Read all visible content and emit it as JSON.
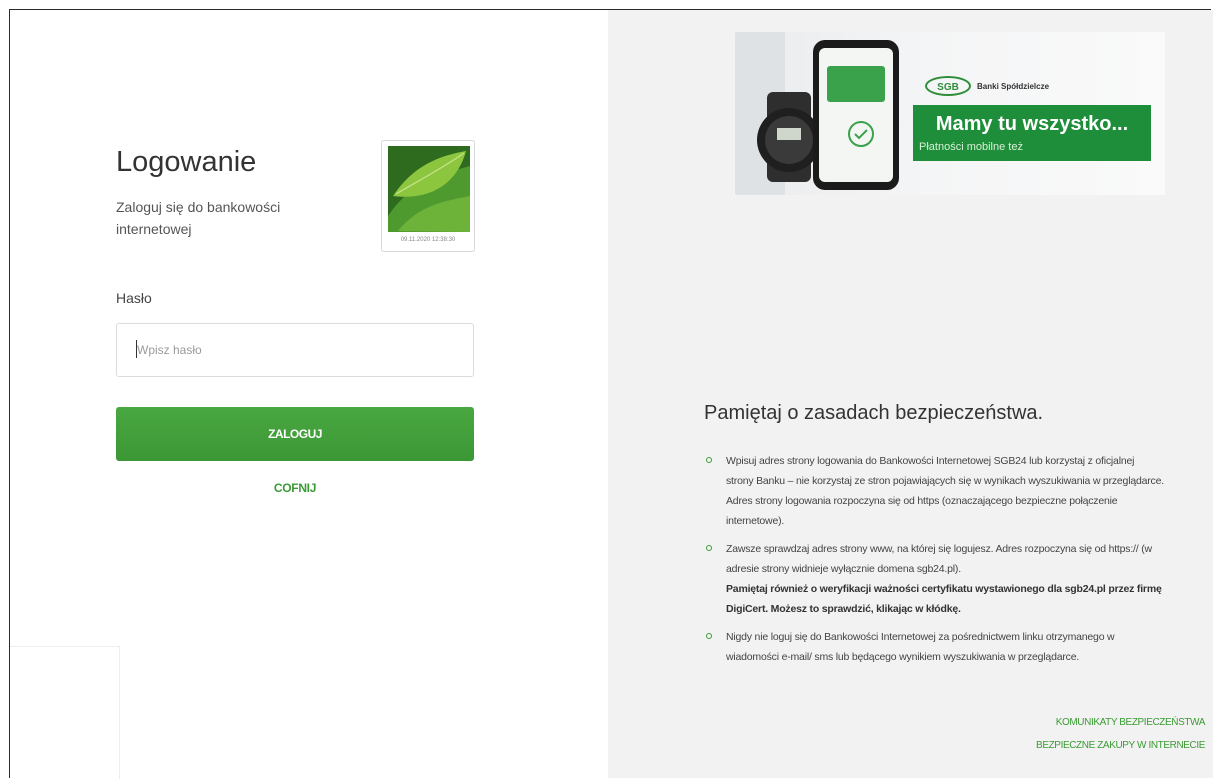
{
  "login": {
    "title": "Logowanie",
    "subtitle": "Zaloguj się do bankowości internetowej",
    "image_date": "09.11.2020 12:38:30",
    "password_label": "Hasło",
    "password_placeholder": "Wpisz hasło",
    "submit_label": "ZALOGUJ",
    "back_label": "COFNIJ"
  },
  "footer_links": [
    "KOMUNIKATY BEZPIECZEŃSTWA",
    "BEZPIECZNE ZAKUPY W INTERNECIE"
  ],
  "banner": {
    "logo": "SGB",
    "brand": "Banki Spółdzielcze",
    "headline": "Mamy tu wszystko...",
    "subline": "Płatności mobilne też"
  },
  "security": {
    "title": "Pamiętaj o zasadach bezpieczeństwa.",
    "item1": "Wpisuj adres strony logowania do Bankowości Internetowej SGB24 lub korzystaj z oficjalnej strony Banku – nie korzystaj ze stron pojawiających się w wynikach wyszukiwania w przeglądarce. Adres strony logowania rozpoczyna się od https (oznaczającego bezpieczne połączenie internetowe).",
    "item2": "Zawsze sprawdzaj adres strony www, na której się logujesz. Adres rozpoczyna się od https:// (w adresie strony widnieje wyłącznie domena sgb24.pl).",
    "item2_bold": "Pamiętaj również o weryfikacji ważności certyfikatu wystawionego dla sgb24.pl przez firmę DigiCert. Możesz to sprawdzić, klikając w kłódkę.",
    "item3": "Nigdy nie loguj się do Bankowości Internetowej za pośrednictwem linku otrzymanego w wiadomości e-mail/ sms lub będącego wynikiem wyszukiwania w przeglądarce."
  },
  "colors": {
    "accent_green": "#3b9b34",
    "panel_gray": "#f2f2f2"
  }
}
